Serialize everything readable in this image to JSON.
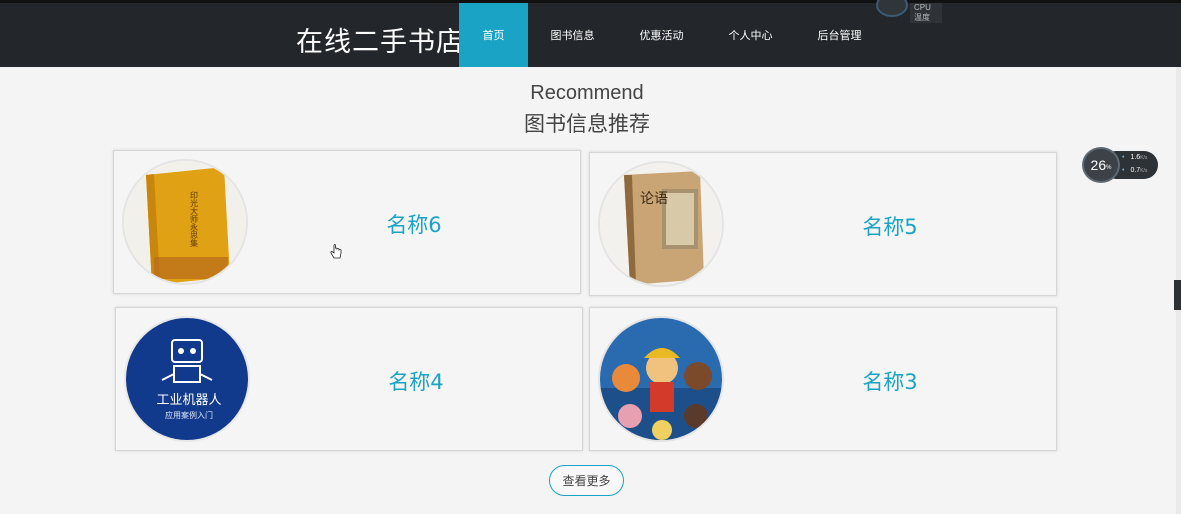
{
  "header": {
    "brand": "在线二手书店",
    "nav": [
      {
        "label": "首页",
        "active": true
      },
      {
        "label": "图书信息",
        "active": false
      },
      {
        "label": "优惠活动",
        "active": false
      },
      {
        "label": "个人中心",
        "active": false
      },
      {
        "label": "后台管理",
        "active": false
      }
    ],
    "cpu_label": "CPU温度"
  },
  "section": {
    "title_en": "Recommend",
    "title_cn": "图书信息推荐"
  },
  "cards": [
    {
      "name": "名称6",
      "cover_text": "印光大师永思集"
    },
    {
      "name": "名称5",
      "cover_text": "论语"
    },
    {
      "name": "名称4",
      "cover_text": "工业机器人",
      "cover_subtext": "应用案例入门"
    },
    {
      "name": "名称3",
      "cover_text": ""
    }
  ],
  "more_button": "查看更多",
  "speed_widget": {
    "percent": "26",
    "percent_unit": "%",
    "up": "1.6",
    "up_unit": "K/s",
    "down": "0.7",
    "down_unit": "K/s"
  },
  "colors": {
    "accent": "#1aa3c4",
    "topbar": "#23272b",
    "background": "#f4f4f4"
  }
}
